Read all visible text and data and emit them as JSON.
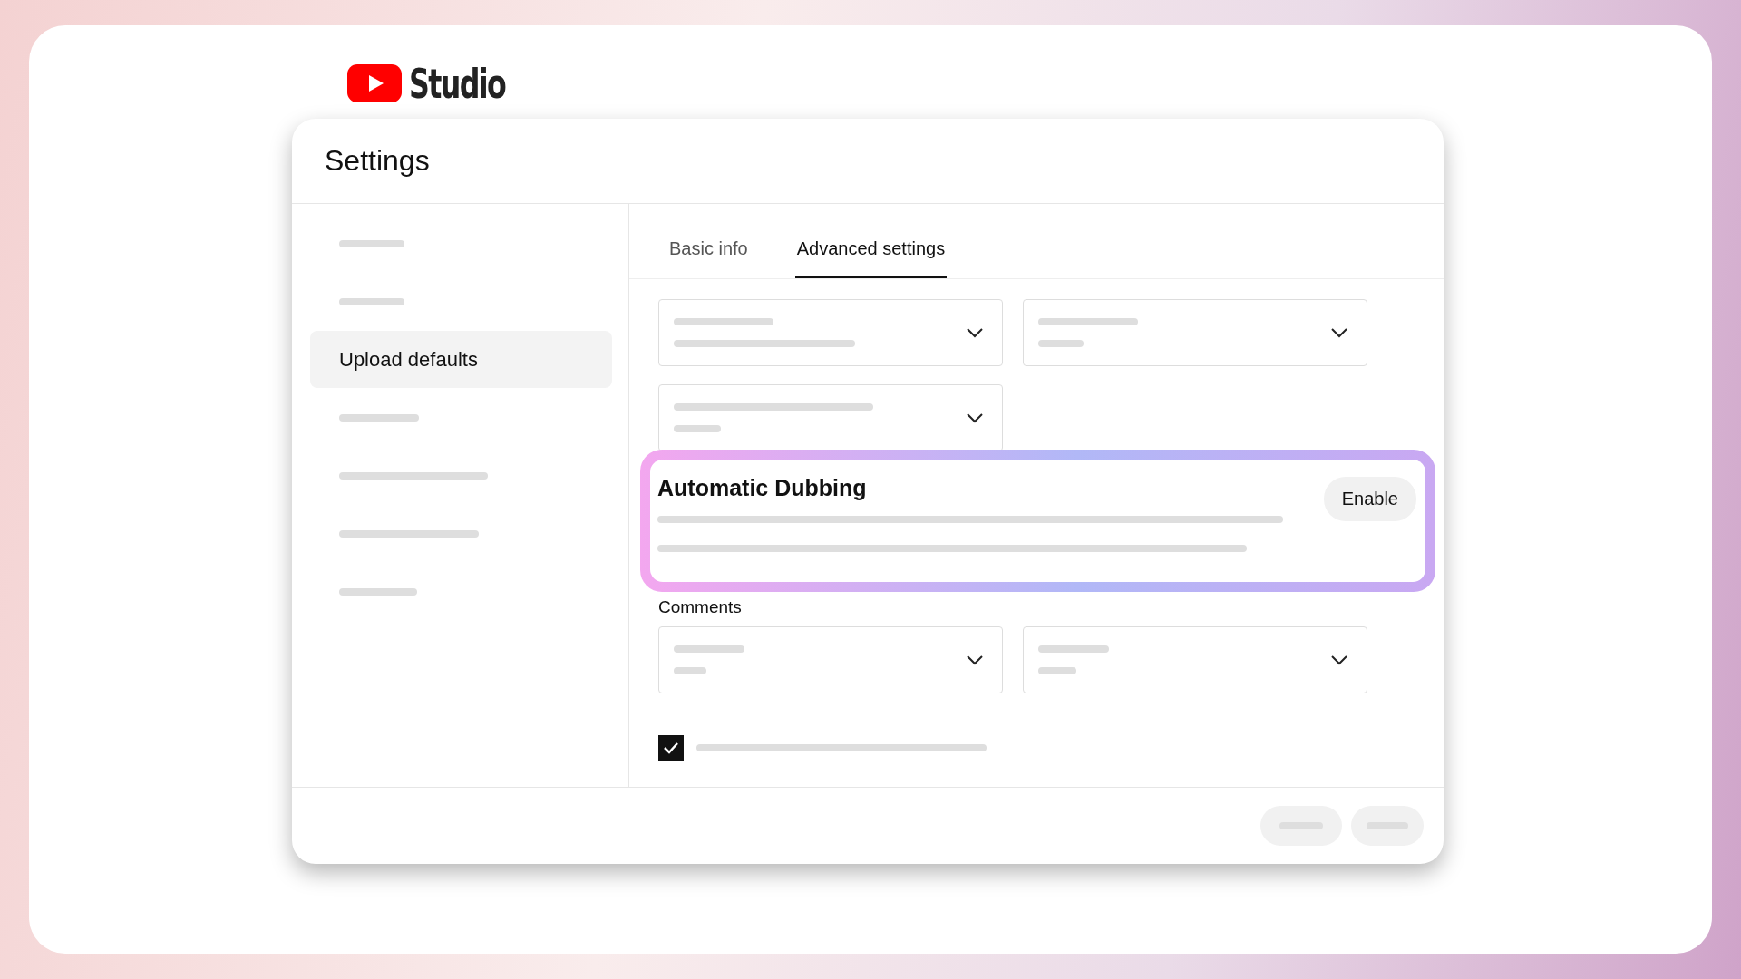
{
  "logo": {
    "text": "Studio"
  },
  "dialog": {
    "title": "Settings"
  },
  "sidebar": {
    "items": [
      {
        "selected": false
      },
      {
        "selected": false
      },
      {
        "label": "Upload defaults",
        "selected": true
      },
      {
        "selected": false
      },
      {
        "selected": false
      },
      {
        "selected": false
      },
      {
        "selected": false
      }
    ]
  },
  "tabs": [
    {
      "label": "Basic info",
      "selected": false
    },
    {
      "label": "Advanced settings",
      "selected": true
    }
  ],
  "feature": {
    "title": "Automatic Dubbing",
    "button": "Enable"
  },
  "comments": {
    "label": "Comments"
  },
  "checkbox": {
    "checked": true
  }
}
